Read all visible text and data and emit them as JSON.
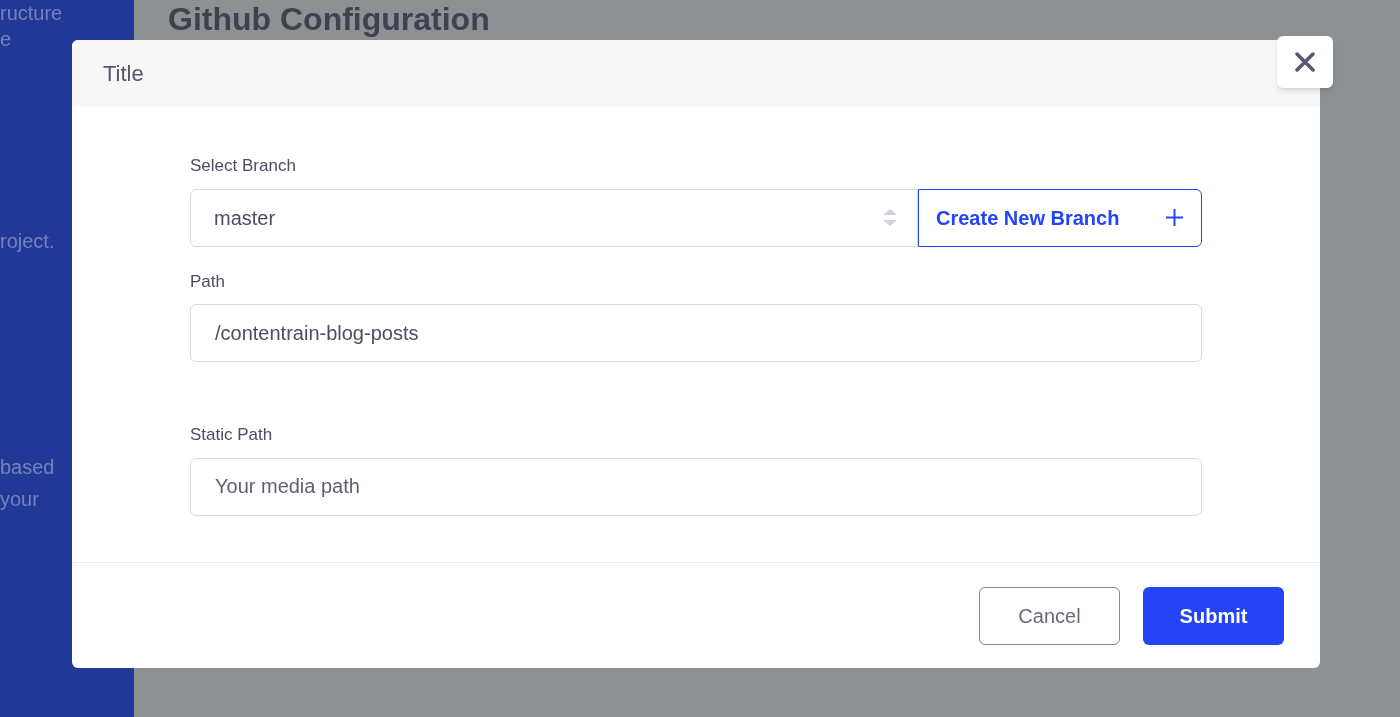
{
  "background": {
    "sidebar_texts": [
      "ructure",
      "e",
      "roject.",
      "based",
      "your"
    ],
    "heading": "Github Configuration"
  },
  "modal": {
    "title": "Title",
    "fields": [
      {
        "kind": "select",
        "label": "Select Branch",
        "value": "master",
        "action": "Create New Branch"
      },
      {
        "kind": "text",
        "label": "Path",
        "value": "/contentrain-blog-posts"
      },
      {
        "kind": "text",
        "label": "Static Path",
        "placeholder": "Your media path"
      }
    ],
    "buttons": [
      {
        "label": "Cancel",
        "kind": "secondary"
      },
      {
        "label": "Submit",
        "kind": "primary"
      }
    ]
  }
}
